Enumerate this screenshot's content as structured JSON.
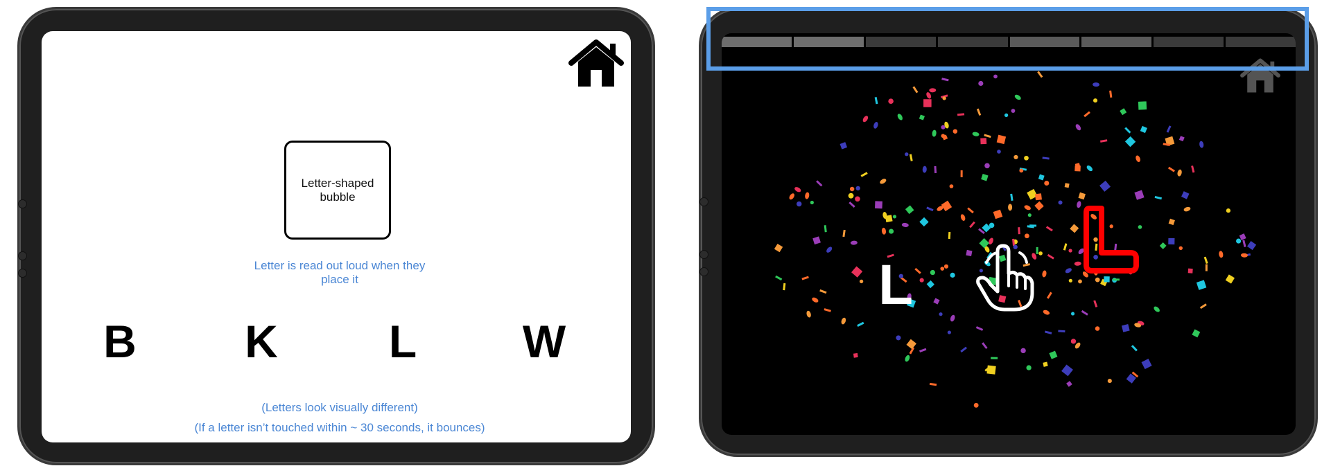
{
  "left_screen": {
    "bubble_label": "Letter-shaped bubble",
    "readout_note": "Letter is read out loud when they place it",
    "letters": [
      "B",
      "K",
      "L",
      "W"
    ],
    "visual_note": "(Letters look visually different)",
    "bounce_note": "(If a letter isn’t touched within ~ 30 seconds, it bounces)",
    "home_icon": "home-icon"
  },
  "right_screen": {
    "placed_letter": "L",
    "target_letter": "L",
    "progress_segments": [
      {
        "color": "#6e6e6e"
      },
      {
        "color": "#6e6e6e"
      },
      {
        "color": "#3a3a3a"
      },
      {
        "color": "#3a3a3a"
      },
      {
        "color": "#5a5a5a"
      },
      {
        "color": "#5a5a5a"
      },
      {
        "color": "#3a3a3a"
      },
      {
        "color": "#3a3a3a"
      }
    ],
    "home_icon": "home-icon",
    "hand_icon": "pointing-hand-icon",
    "confetti_colors": [
      "#e8315a",
      "#3d3dbb",
      "#1fc7e0",
      "#2fc85a",
      "#f0d020",
      "#f59a3a",
      "#9b3db8",
      "#ff6a2a"
    ]
  },
  "colors": {
    "annotation_blue": "#4a86d4",
    "highlight_blue": "#5b9ee8",
    "target_outline": "#ff0000"
  }
}
